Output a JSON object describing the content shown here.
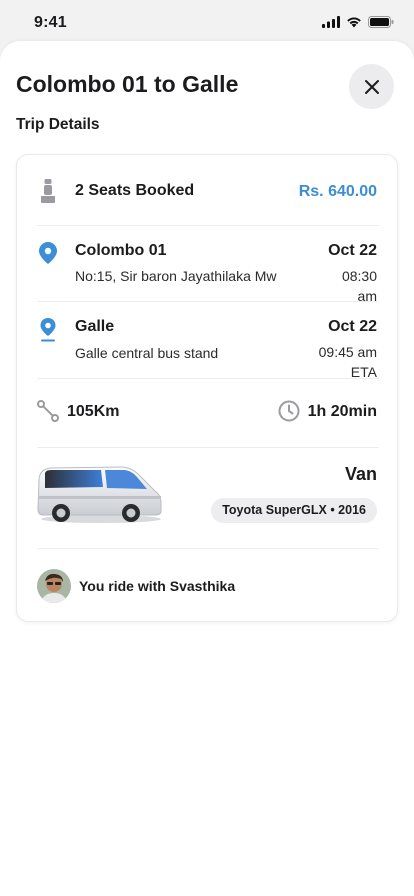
{
  "status_bar": {
    "time": "9:41"
  },
  "header": {
    "title": "Colombo 01 to Galle",
    "close_icon": "close-icon"
  },
  "section": {
    "label": "Trip Details"
  },
  "booking": {
    "seats_label": "2 Seats Booked",
    "price": "Rs. 640.00",
    "seat_icon": "seat-icon"
  },
  "origin": {
    "name": "Colombo 01",
    "address": "No:15, Sir baron Jayathilaka Mw",
    "date": "Oct 22",
    "time_line1": "08:30",
    "time_line2": "am",
    "icon": "location-pin-icon"
  },
  "destination": {
    "name": "Galle",
    "address": "Galle central bus stand",
    "date": "Oct 22",
    "time_line1": "09:45 am",
    "time_line2": "ETA",
    "icon": "destination-pin-icon"
  },
  "trip_stats": {
    "distance": "105Km",
    "duration": "1h 20min",
    "route_icon": "route-icon",
    "clock_icon": "clock-icon"
  },
  "vehicle": {
    "type": "Van",
    "model": "Toyota SuperGLX • 2016",
    "image": "van-image"
  },
  "driver": {
    "text": "You ride with Svasthika",
    "avatar": "driver-avatar"
  },
  "colors": {
    "accent": "#3c8ed4",
    "pin": "#3a8fd6",
    "icon_gray": "#9a9aa0"
  }
}
